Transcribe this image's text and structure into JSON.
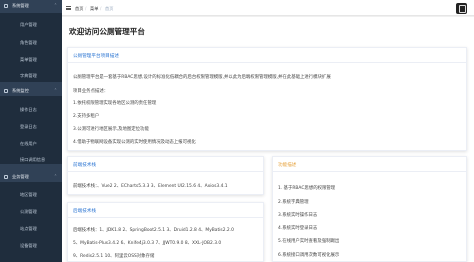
{
  "sidebar": {
    "groups": [
      {
        "label": "系统管理",
        "items": [
          "用户管理",
          "角色管理",
          "菜单管理",
          "字典管理"
        ]
      },
      {
        "label": "系统监控",
        "items": [
          "操作日志",
          "登录日志",
          "在线用户",
          "接口调用信息"
        ]
      },
      {
        "label": "业务管理",
        "items": [
          "地区管理",
          "公测管理",
          "站点管理",
          "设备管理"
        ]
      }
    ]
  },
  "topbar": {
    "breadcrumbs": [
      "首页",
      "菜单",
      "首页"
    ]
  },
  "main": {
    "page_title": "欢迎访问公厕管理平台",
    "description": {
      "header": "公厕管理平台项目描述",
      "intro": "公厕管理平台是一套基于RBAC思想,设计的标准化低耦合的后台权限管理模版,并以此为后端权限管理模版,并在此基础上进行模块扩展",
      "business_title": "项目业务点描述：",
      "points": [
        "1.依托权限管理实现各地区公测的责任管理",
        "2.支持多租户",
        "3.公测可进行地区展示,及地图定位功能",
        "4.借助于物联网设备实现公测的实时使用情况及动态上报可视化"
      ]
    },
    "frontend": {
      "header": "前端技术栈",
      "content": "前端技术栈：、Vue2 2、ECharts5.3.3 3、Element UI2.15.6 4、Axios3.4.1"
    },
    "backend": {
      "header": "后端技术栈",
      "lines": [
        "后端技术栈：1、JDK1.8 2、SpringBoot2.5.1 3、Druid1.2.8 4、MyBatis2.2.0",
        "5、MyBatis-Plus3.4.2 6、Knife4j3.0.3 7、JJWT0.9.0 8、XXL-JOB2.3.0",
        "9、Redis2.5.1 10、阿里云OSS对象存储"
      ]
    },
    "features": {
      "header": "功能描述",
      "items": [
        "1. 基于RBAC思想的权限管理",
        "2.系统字典管理",
        "3.系统实时操作日志",
        "4.系统实时登录日志",
        "5.在线用户实时查看及强制踢出",
        "6.系统接口调用次数可视化展示"
      ]
    }
  },
  "colors": {
    "sidebar": "#304156",
    "accent": "#2a74d2",
    "features_header": "#e6a23c"
  }
}
